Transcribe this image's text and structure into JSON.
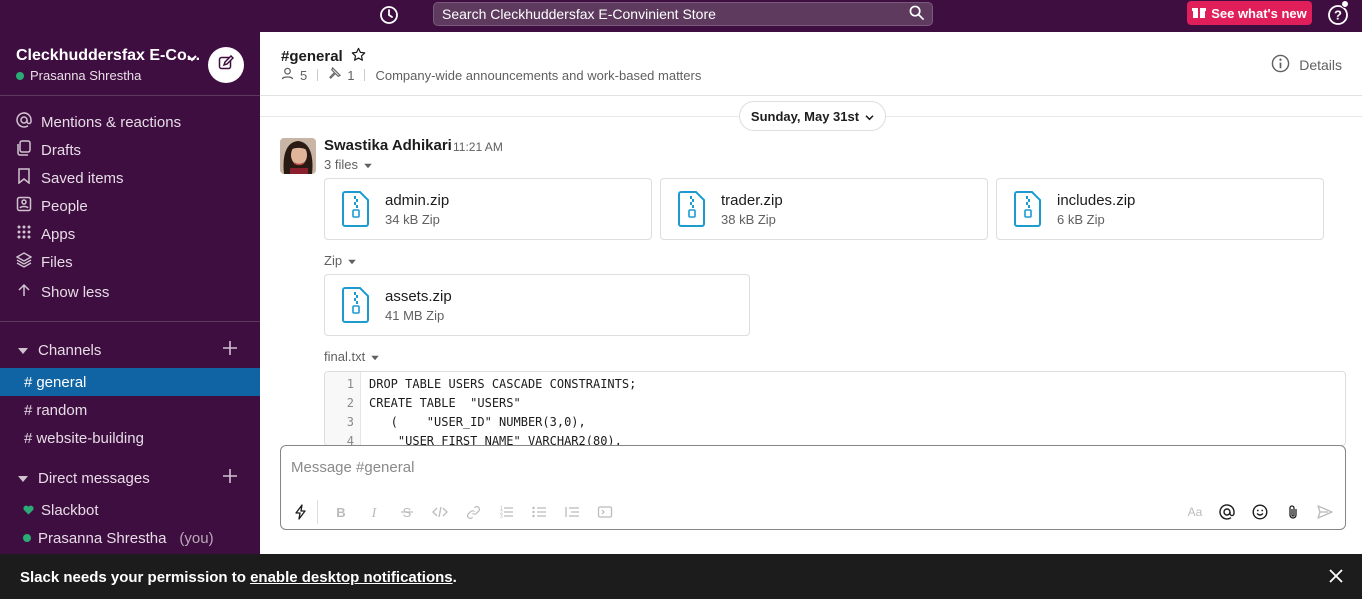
{
  "topbar": {
    "search_placeholder": "Search Cleckhuddersfax E-Convinient Store",
    "whats_new_label": "See what's new"
  },
  "workspace": {
    "name": "Cleckhuddersfax E-Co...",
    "user": "Prasanna Shrestha"
  },
  "sidebar": {
    "nav": [
      {
        "label": "Mentions & reactions",
        "icon": "at-icon"
      },
      {
        "label": "Drafts",
        "icon": "drafts-icon"
      },
      {
        "label": "Saved items",
        "icon": "bookmark-icon"
      },
      {
        "label": "People",
        "icon": "people-icon"
      },
      {
        "label": "Apps",
        "icon": "apps-grid-icon"
      },
      {
        "label": "Files",
        "icon": "files-stack-icon"
      },
      {
        "label": "Show less",
        "icon": "arrow-up-icon"
      }
    ],
    "channels_label": "Channels",
    "channels": [
      "general",
      "random",
      "website-building"
    ],
    "dm_label": "Direct messages",
    "dms": [
      {
        "name": "Slackbot",
        "suffix": ""
      },
      {
        "name": "Prasanna Shrestha",
        "suffix": "(you)"
      }
    ]
  },
  "channel": {
    "title": "#general",
    "members": "5",
    "pins": "1",
    "topic": "Company-wide announcements and work-based matters",
    "details_label": "Details"
  },
  "messages": {
    "date": "Sunday, May 31st",
    "sender": "Swastika Adhikari",
    "time": "11:21 AM",
    "files_label": "3 files",
    "files": [
      {
        "name": "admin.zip",
        "size": "34 kB Zip"
      },
      {
        "name": "trader.zip",
        "size": "38 kB Zip"
      },
      {
        "name": "includes.zip",
        "size": "6 kB Zip"
      }
    ],
    "zip_label": "Zip",
    "zip_file": {
      "name": "assets.zip",
      "size": "41 MB Zip"
    },
    "text_file_label": "final.txt",
    "code_lines": [
      {
        "n": "1",
        "text": "DROP TABLE USERS CASCADE CONSTRAINTS;"
      },
      {
        "n": "2",
        "text": "CREATE TABLE  \"USERS\""
      },
      {
        "n": "3",
        "text": "   (    \"USER_ID\" NUMBER(3,0),"
      },
      {
        "n": "4",
        "text": "    \"USER_FIRST_NAME\" VARCHAR2(80),"
      }
    ]
  },
  "composer": {
    "placeholder": "Message #general"
  },
  "notification": {
    "prefix": "Slack needs your permission to ",
    "link": "enable desktop notifications",
    "suffix": "."
  },
  "colors": {
    "sidebar_bg": "#3f0e40",
    "active_channel": "#1164a3",
    "whats_new_bg": "#e01e5a",
    "presence_green": "#2bac76",
    "zip_icon": "#1d9bd1"
  }
}
